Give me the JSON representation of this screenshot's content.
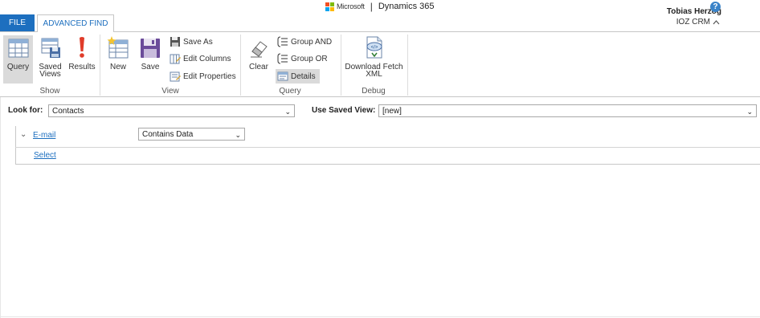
{
  "brand": {
    "microsoft": "Microsoft",
    "separator": "|",
    "product": "Dynamics 365"
  },
  "user": {
    "name": "Tobias Herzog",
    "org": "IOZ CRM"
  },
  "tabs": {
    "file": "FILE",
    "advanced_find": "ADVANCED FIND"
  },
  "ribbon": {
    "show": {
      "label": "Show",
      "query": "Query",
      "saved_views": "Saved Views",
      "results": "Results"
    },
    "view": {
      "label": "View",
      "new": "New",
      "save": "Save",
      "save_as": "Save As",
      "edit_columns": "Edit Columns",
      "edit_properties": "Edit Properties"
    },
    "query": {
      "label": "Query",
      "clear": "Clear",
      "group_and": "Group AND",
      "group_or": "Group OR",
      "details": "Details"
    },
    "debug": {
      "label": "Debug",
      "download_fetch_xml": "Download Fetch XML"
    }
  },
  "lookfor": {
    "label": "Look for:",
    "value": "Contacts"
  },
  "saved_view": {
    "label": "Use Saved View:",
    "value": "[new]"
  },
  "conditions": [
    {
      "field": "E-mail",
      "operator": "Contains Data"
    }
  ],
  "select_link": "Select",
  "colors": {
    "accent": "#1d6fbf",
    "ribbon_selected": "#dadada"
  }
}
